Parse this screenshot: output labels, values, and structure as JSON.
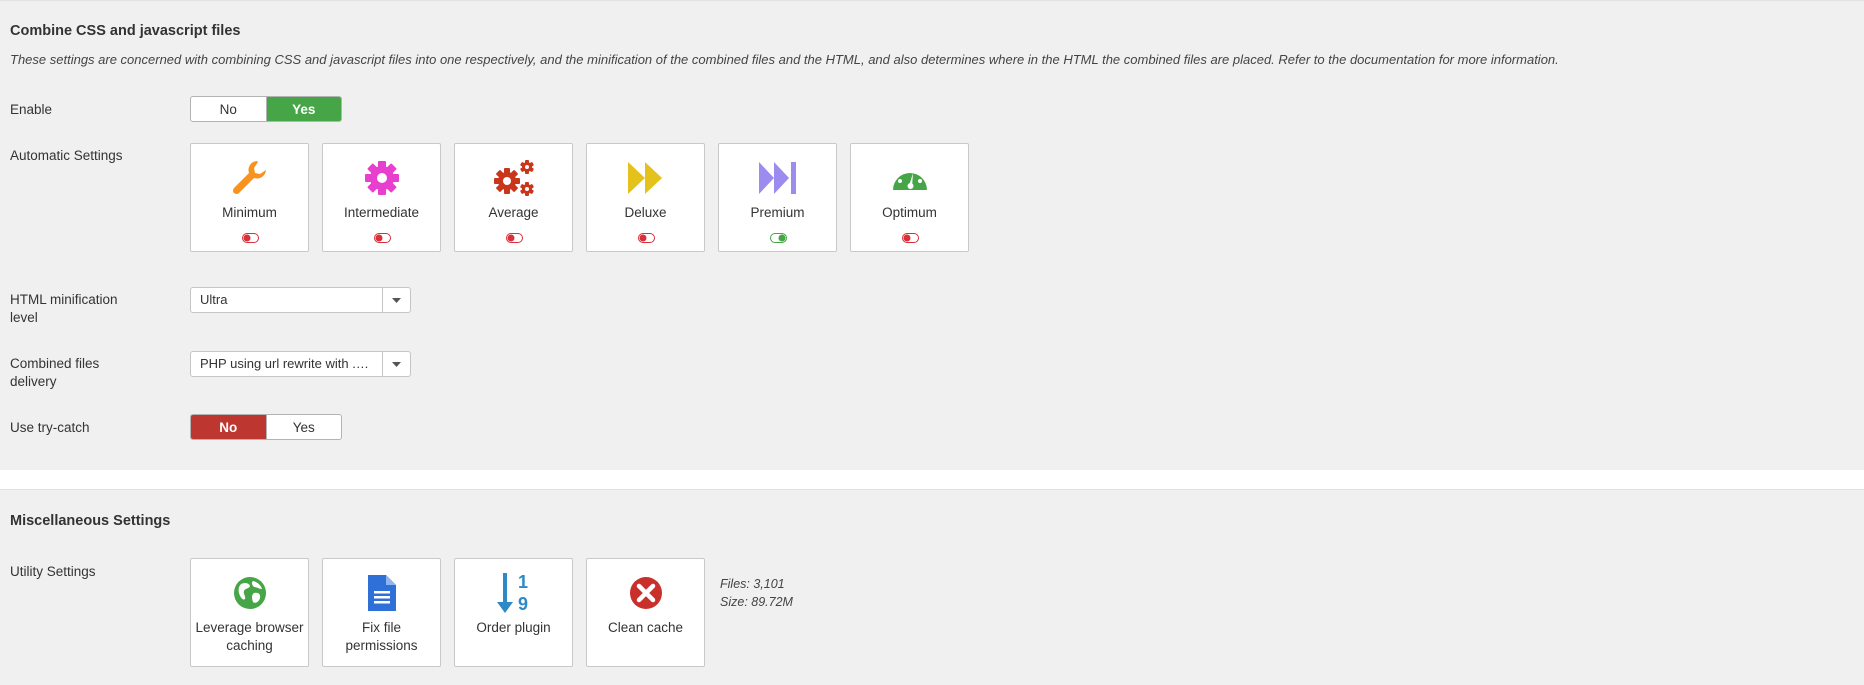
{
  "combine": {
    "title": "Combine CSS and javascript files",
    "description": "These settings are concerned with combining CSS and javascript files into one respectively, and the minification of the combined files and the HTML, and also determines where in the HTML the combined files are placed. Refer to the documentation for more information.",
    "enable": {
      "label": "Enable",
      "no": "No",
      "yes": "Yes",
      "selected": "Yes"
    },
    "automatic": {
      "label": "Automatic Settings",
      "tiles": [
        {
          "label": "Minimum",
          "icon": "wrench-icon",
          "color": "#f7931e",
          "enabled": false
        },
        {
          "label": "Intermediate",
          "icon": "cog-icon",
          "color": "#e83fcf",
          "enabled": false
        },
        {
          "label": "Average",
          "icon": "cogs-icon",
          "color": "#c9361c",
          "enabled": false
        },
        {
          "label": "Deluxe",
          "icon": "fast-forward-icon",
          "color": "#e5c11b",
          "enabled": false
        },
        {
          "label": "Premium",
          "icon": "step-forward-icon",
          "color": "#9c8cf0",
          "enabled": true
        },
        {
          "label": "Optimum",
          "icon": "dashboard-icon",
          "color": "#46a546",
          "enabled": false
        }
      ]
    },
    "html_minification": {
      "label_line1": "HTML minification",
      "label_line2": "level",
      "value": "Ultra"
    },
    "delivery": {
      "label_line1": "Combined files",
      "label_line2": "delivery",
      "value": "PHP using url rewrite with .htaccess"
    },
    "try_catch": {
      "label": "Use try-catch",
      "no": "No",
      "yes": "Yes",
      "selected": "No"
    }
  },
  "misc": {
    "title": "Miscellaneous Settings",
    "utility": {
      "label": "Utility Settings",
      "tiles": [
        {
          "line1": "Leverage browser",
          "line2": "caching",
          "icon": "globe-icon",
          "color": "#46a546"
        },
        {
          "line1": "Fix file",
          "line2": "permissions",
          "icon": "file-icon",
          "color": "#2f6fd8"
        },
        {
          "line1": "Order plugin",
          "line2": "",
          "icon": "sort-numeric-icon",
          "color": "#2d8ac7"
        },
        {
          "line1": "Clean cache",
          "line2": "",
          "icon": "remove-icon",
          "color": "#c9302c"
        }
      ],
      "files": "Files: 3,101",
      "size": "Size: 89.72M"
    }
  },
  "colors": {
    "toggle_on": "#46a546",
    "toggle_off": "#d9303c",
    "yes_active": "#46a546",
    "no_active": "#bd362f"
  }
}
